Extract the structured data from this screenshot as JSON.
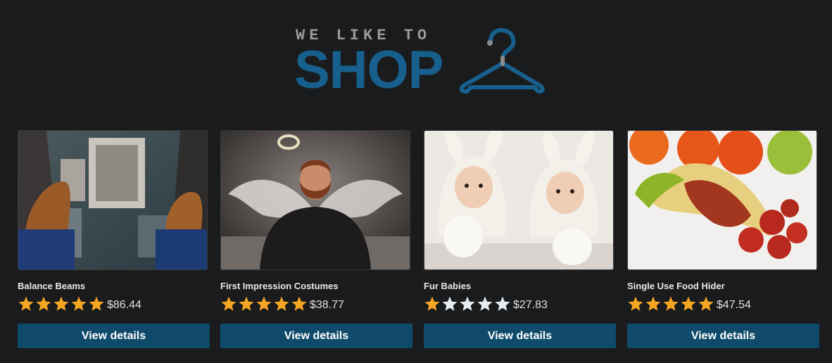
{
  "logo": {
    "tagline": "WE LIKE TO",
    "wordmark": "SHOP",
    "icon": "hanger-icon",
    "color": "#175f8c"
  },
  "colors": {
    "background": "#1a1b1d",
    "button": "#0f4a6a",
    "star_filled": "#f5a623",
    "star_empty": "#e6ecf0"
  },
  "products": [
    {
      "name": "Balance Beams",
      "price": "$86.44",
      "rating": 5,
      "button": "View details",
      "image": "shoes-over-city-image"
    },
    {
      "name": "First Impression Costumes",
      "price": "$38.77",
      "rating": 5,
      "button": "View details",
      "image": "angel-costume-image"
    },
    {
      "name": "Fur Babies",
      "price": "$27.83",
      "rating": 1,
      "button": "View details",
      "image": "babies-in-bunny-suits-image"
    },
    {
      "name": "Single Use Food Hider",
      "price": "$47.54",
      "rating": 5,
      "button": "View details",
      "image": "sausage-in-banana-image"
    }
  ]
}
